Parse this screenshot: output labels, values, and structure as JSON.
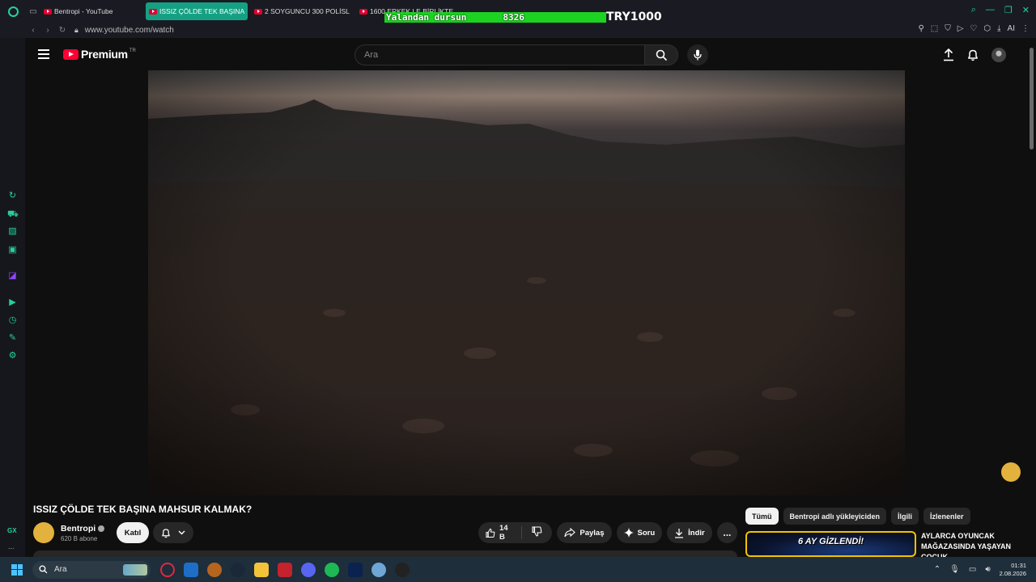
{
  "browser": {
    "tabs": [
      {
        "title": "Bentropi - YouTube",
        "active": false
      },
      {
        "title": "ISSIZ ÇÖLDE TEK BAŞINA",
        "active": true
      },
      {
        "title": "2 SOYGUNCU 300 POLİSL",
        "active": false
      },
      {
        "title": "1600 ERKEK LE BİRLİKTE",
        "active": false
      }
    ],
    "url": "www.youtube.com/watch",
    "ai_label": "AI"
  },
  "stream_overlay": {
    "text": "Yalandan dursun",
    "count": "8326",
    "amount": "TRY1000",
    "color": "#1cd321"
  },
  "sidebar": {
    "icons": [
      "refresh-icon",
      "bag-icon",
      "leaf-icon",
      "music-icon",
      "twitch-icon",
      "play-icon",
      "history-icon",
      "puzzle-icon",
      "settings-icon"
    ],
    "gx_label": "GX",
    "more_label": "..."
  },
  "youtube": {
    "logo_text": "Premium",
    "country_code": "TR",
    "search_placeholder": "Ara"
  },
  "video": {
    "title": "ISSIZ ÇÖLDE TEK BAŞINA MAHSUR KALMAK?",
    "channel": "Bentropi",
    "subscribers": "620 B abone",
    "join_label": "Katıl",
    "likes": "14 B",
    "share_label": "Paylaş",
    "ask_label": "Soru",
    "download_label": "İndir",
    "more_label": "..."
  },
  "chips": [
    "Tümü",
    "Bentropi adlı yükleyiciden",
    "İlgili",
    "İzlenenler"
  ],
  "recommendation": {
    "thumb_text": "6 AY GİZLENDİ!",
    "title": "AYLARCA OYUNCAK MAĞAZASINDA YAŞAYAN ÇOCUK"
  },
  "taskbar": {
    "search_placeholder": "Ara",
    "time": "01:31",
    "date": "2.08.2026"
  },
  "colors": {
    "accent": "#25d0a0",
    "yt_red": "#ff0033",
    "thumb_border": "#f2c200"
  }
}
